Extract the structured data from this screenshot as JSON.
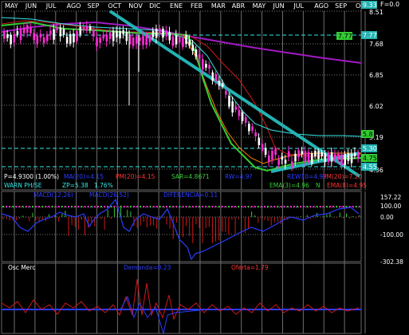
{
  "top_right": {
    "f_label": "F=0.0"
  },
  "months": [
    "MAY",
    "JUN",
    "JUL",
    "AGO",
    "SEP",
    "OCT",
    "NOV",
    "DIC",
    "ENE",
    "FEB",
    "MAR",
    "ABR",
    "MAY",
    "JUN",
    "JUL",
    "AGO",
    "SEP",
    "OCT"
  ],
  "price_axis": {
    "ticks": [
      "8.51",
      "7.68",
      "6.85",
      "6.02",
      "5.19",
      "4.36"
    ],
    "top_badge": "9.33",
    "badge_777": "7.77",
    "badge_58": "5.8",
    "badge_530": "5.30",
    "badge_475": "4.75",
    "badge_455": "4.55"
  },
  "price_panel": {
    "left_value_badge": "7.77",
    "info_line1": {
      "p": "P=4.9300 (1.00%)",
      "ma": "MA(20)=4.15",
      "pm": "PM(20)=4.15",
      "sar": "SAR=4.8671",
      "rw": "RW=4.9?",
      "rew": "REW10=4.95",
      "pm20b": "PM(20)=7.20"
    },
    "info_line2": {
      "warn": "WARN PH/SE",
      "zp": "ZP=5.38",
      "pct": "1.76%",
      "ema3": "EMA(3)=4.96",
      "n": "N",
      "ema": "EMA(8)=4.95"
    }
  },
  "macd_panel": {
    "labels": [
      "MACD(12,26)",
      "MACD(26,52)",
      "DIFERENCIA=0.11"
    ],
    "ticks": [
      "157.22",
      "100.00",
      "0.00",
      "-100.00",
      "-302.38"
    ]
  },
  "osc_panel": {
    "title": "Osc Merc",
    "demanda": "Demanda=0.23",
    "oferta": "Oferta=1.79"
  },
  "colors": {
    "bg": "#000000",
    "grid": "#7a7a7a",
    "candle_up": "#ffffff",
    "candle_down": "#ff2bd6",
    "teal": "#24b3b3",
    "purple": "#a31ac3",
    "red": "#d01818",
    "green": "#33cc33",
    "cyan": "#37e6e6",
    "blue": "#2a3cff",
    "orange": "#ff8000"
  }
}
